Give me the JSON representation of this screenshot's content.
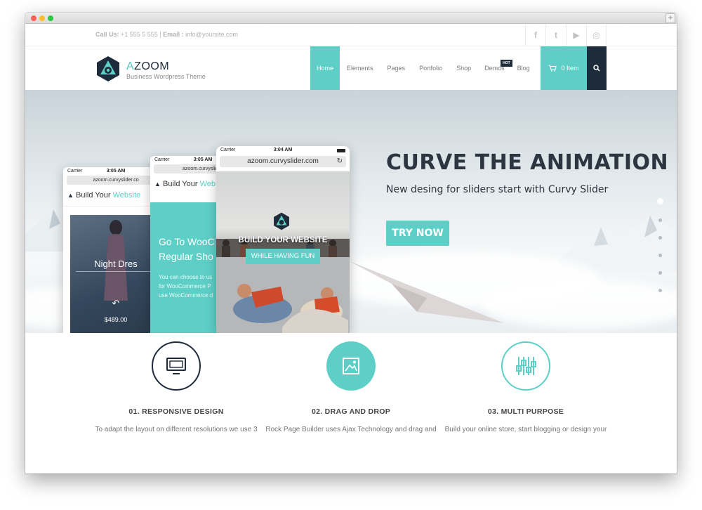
{
  "topbar": {
    "call_label": "Call Us:",
    "phone": " +1 555 5 555 | ",
    "email_label": "Email :",
    "email": " info@yoursite.com",
    "socials": [
      "f",
      "t",
      "▶",
      "◎"
    ]
  },
  "brand": {
    "title_accent": "A",
    "title_rest": "ZOOM",
    "tagline": "Business Wordpress Theme"
  },
  "nav": {
    "items": [
      "Home",
      "Elements",
      "Pages",
      "Portfolio",
      "Shop",
      "Demos",
      "Blog"
    ],
    "hot_badge": "HOT",
    "cart_label": "0 Item"
  },
  "hero": {
    "title": "CURVE THE ANIMATION",
    "subtitle": "New desing for sliders start with Curvy Slider",
    "cta": "TRY NOW"
  },
  "phones": {
    "left": {
      "carrier": "Carrier",
      "time": "3:05 AM",
      "url": "azoom.curvyslider.co",
      "heading_a": "Build Your ",
      "heading_b": "Website",
      "caption": "Night Dres",
      "price": "$489.00"
    },
    "middle": {
      "carrier": "Carrier",
      "time": "3:05 AM",
      "url": "azoom.curvyslider.",
      "heading_a": "Build Your ",
      "heading_b": "Web",
      "line1": "Go To WooC",
      "line2": "Regular Sho",
      "body1": "You can choose to us",
      "body2": "for WooCommerce P",
      "body3": "use WooCommerce d"
    },
    "front": {
      "carrier": "Carrier",
      "time": "3:04 AM",
      "url": "azoom.curvyslider.com",
      "headline": "BUILD YOUR WEBSITE",
      "button": "WHILE HAVING FUN"
    }
  },
  "features": [
    {
      "title": "01. RESPONSIVE DESIGN",
      "text": "To adapt the layout on different resolutions we use 3"
    },
    {
      "title": "02. DRAG AND DROP",
      "text": "Rock Page Builder uses Ajax Technology and drag and"
    },
    {
      "title": "03. MULTI PURPOSE",
      "text": "Build your online store, start blogging or design your"
    }
  ],
  "colors": {
    "accent": "#5ecfc6",
    "dark": "#1e2b3a"
  }
}
